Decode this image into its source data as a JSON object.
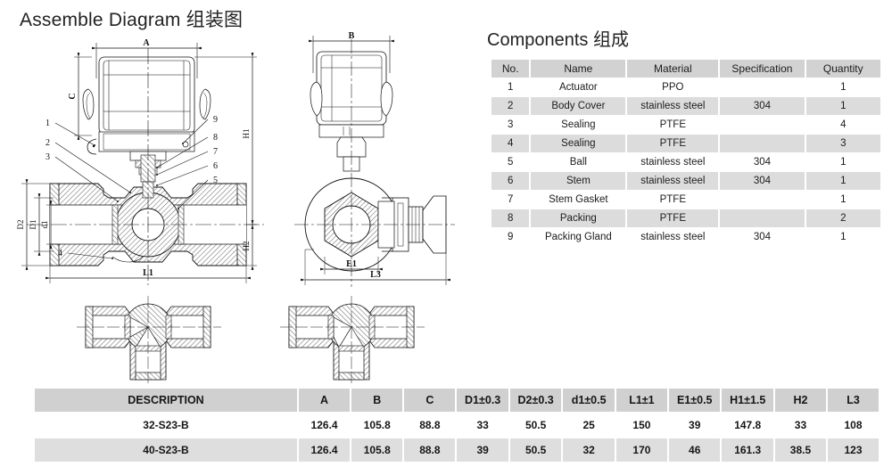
{
  "page": {
    "title": "Assemble Diagram 组装图",
    "components_title": "Components 组成"
  },
  "drawing": {
    "dimension_labels": {
      "A": "A",
      "B": "B",
      "C": "C",
      "D1": "D1",
      "D2": "D2",
      "d1": "d1",
      "L1": "L1",
      "L3": "L3",
      "E1": "E1",
      "H1": "H1",
      "H2": "H2"
    },
    "callouts": [
      "1",
      "2",
      "3",
      "4",
      "5",
      "6",
      "7",
      "8",
      "9"
    ],
    "views": {
      "t_type": "T-Type",
      "l_type": "L-Type"
    }
  },
  "components_table": {
    "headers": [
      "No.",
      "Name",
      "Material",
      "Specification",
      "Quantity"
    ],
    "rows": [
      {
        "no": "1",
        "name": "Actuator",
        "material": "PPO",
        "specification": "",
        "quantity": "1"
      },
      {
        "no": "2",
        "name": "Body Cover",
        "material": "stainless steel",
        "specification": "304",
        "quantity": "1"
      },
      {
        "no": "3",
        "name": "Sealing",
        "material": "PTFE",
        "specification": "",
        "quantity": "4"
      },
      {
        "no": "4",
        "name": "Sealing",
        "material": "PTFE",
        "specification": "",
        "quantity": "3"
      },
      {
        "no": "5",
        "name": "Ball",
        "material": "stainless steel",
        "specification": "304",
        "quantity": "1"
      },
      {
        "no": "6",
        "name": "Stem",
        "material": "stainless steel",
        "specification": "304",
        "quantity": "1"
      },
      {
        "no": "7",
        "name": "Stem Gasket",
        "material": "PTFE",
        "specification": "",
        "quantity": "1"
      },
      {
        "no": "8",
        "name": "Packing",
        "material": "PTFE",
        "specification": "",
        "quantity": "2"
      },
      {
        "no": "9",
        "name": "Packing Gland",
        "material": "stainless steel",
        "specification": "304",
        "quantity": "1"
      }
    ]
  },
  "spec_table": {
    "headers": [
      "DESCRIPTION",
      "A",
      "B",
      "C",
      "D1±0.3",
      "D2±0.3",
      "d1±0.5",
      "L1±1",
      "E1±0.5",
      "H1±1.5",
      "H2",
      "L3"
    ],
    "rows": [
      {
        "description": "32-S23-B",
        "values": [
          "126.4",
          "105.8",
          "88.8",
          "33",
          "50.5",
          "25",
          "150",
          "39",
          "147.8",
          "33",
          "108"
        ]
      },
      {
        "description": "40-S23-B",
        "values": [
          "126.4",
          "105.8",
          "88.8",
          "39",
          "50.5",
          "32",
          "170",
          "46",
          "161.3",
          "38.5",
          "123"
        ]
      }
    ]
  },
  "colors": {
    "header_gray": "#d2d2d2",
    "row_gray": "#dcdcdc",
    "row_white": "#ffffff",
    "line": "#111111"
  }
}
